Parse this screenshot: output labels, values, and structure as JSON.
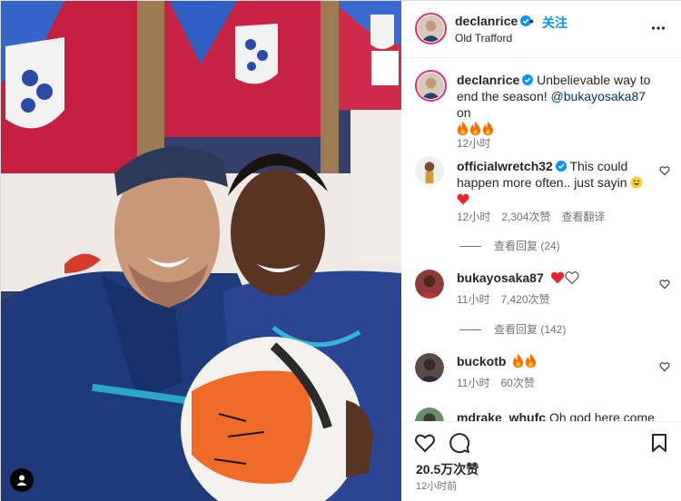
{
  "post": {
    "username": "declanrice",
    "dot": "•",
    "follow_label": "关注",
    "location": "Old Trafford"
  },
  "caption": {
    "username": "declanrice",
    "text": "Unbelievable way to end the season!",
    "mention": "@bukayosaka87",
    "tail": "on",
    "emoji": [
      "fire",
      "fire",
      "fire"
    ],
    "time": "12小时"
  },
  "comments": [
    {
      "username": "officialwretch32",
      "verified": true,
      "text": "This could happen more often.. just sayin",
      "time": "12小时",
      "likes": "2,304次赞",
      "translate": "查看翻译",
      "replies": "查看回复 (24)"
    },
    {
      "username": "bukayosaka87",
      "verified": false,
      "text": "",
      "time": "11小时",
      "likes": "7,420次赞",
      "replies": "查看回复 (142)"
    },
    {
      "username": "buckotb",
      "verified": false,
      "text": "",
      "time": "11小时",
      "likes": "60次赞"
    },
    {
      "username": "mdrake_whufc",
      "verified": false,
      "text": "Oh god here come"
    }
  ],
  "footer": {
    "likes": "20.5万次赞",
    "posted": "12小时前"
  },
  "colors": {
    "follow_blue": "#0095f6",
    "verified_blue": "#0095f6",
    "mention": "#00376b",
    "heart_red": "#ed4956",
    "fire": "#ff6a00"
  },
  "icons": {
    "like": "heart-icon",
    "comment": "comment-icon",
    "save": "bookmark-icon",
    "more": "more-options-icon",
    "user_tags": "user-tag-icon"
  }
}
